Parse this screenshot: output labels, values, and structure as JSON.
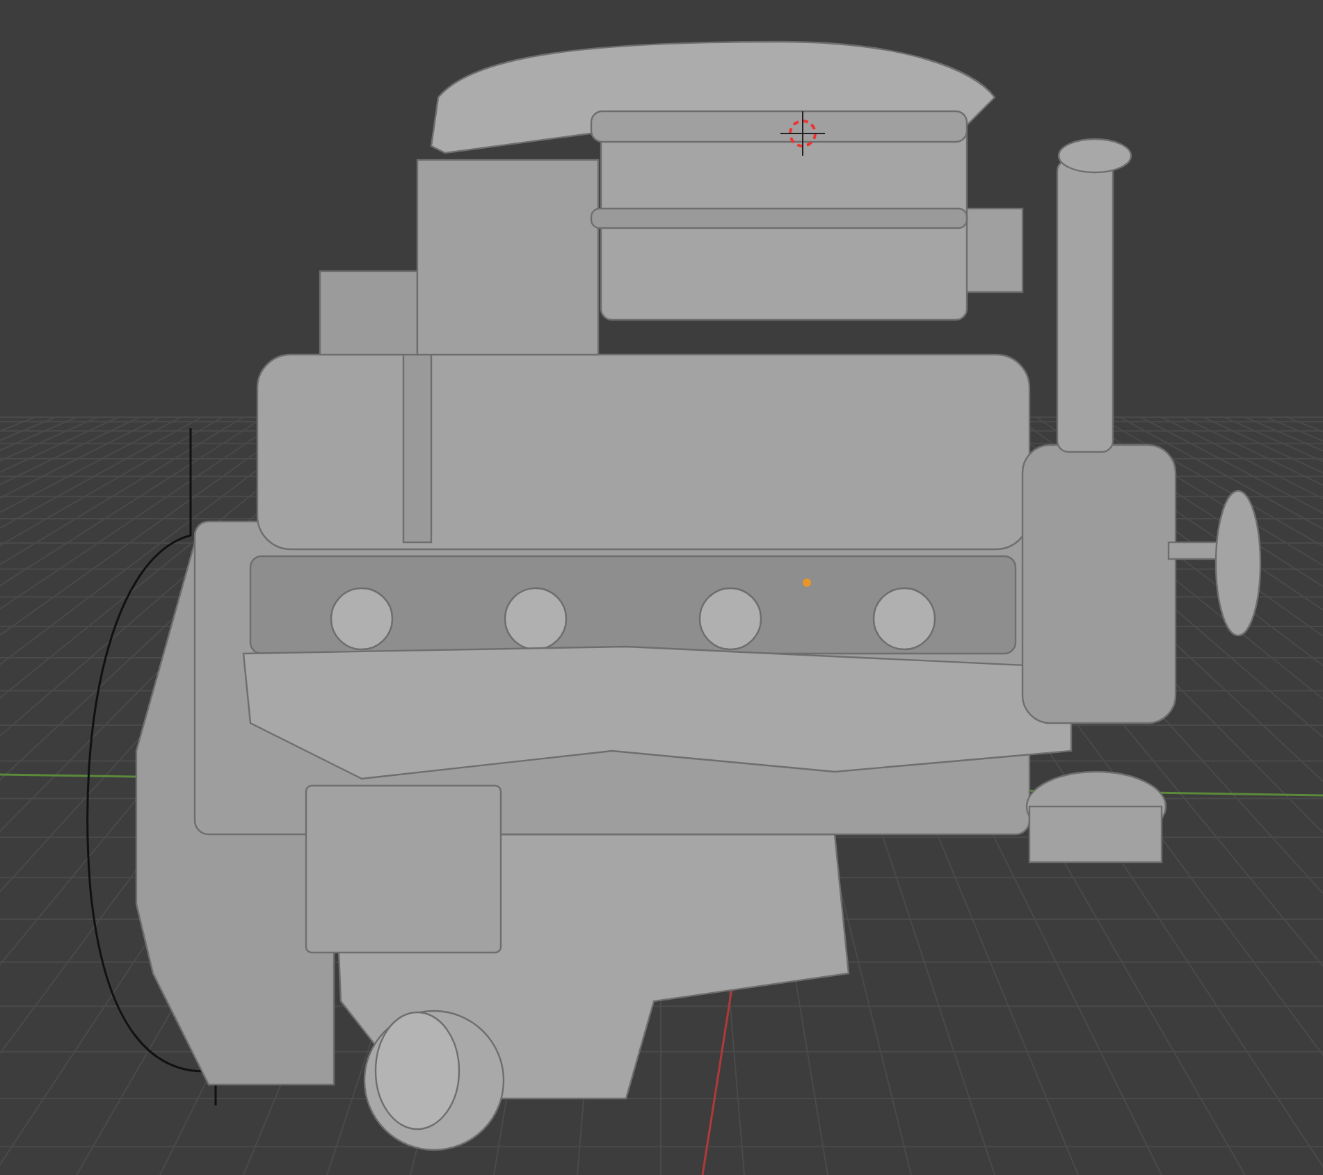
{
  "viewport": {
    "grid": true,
    "axis_lines": true
  }
}
